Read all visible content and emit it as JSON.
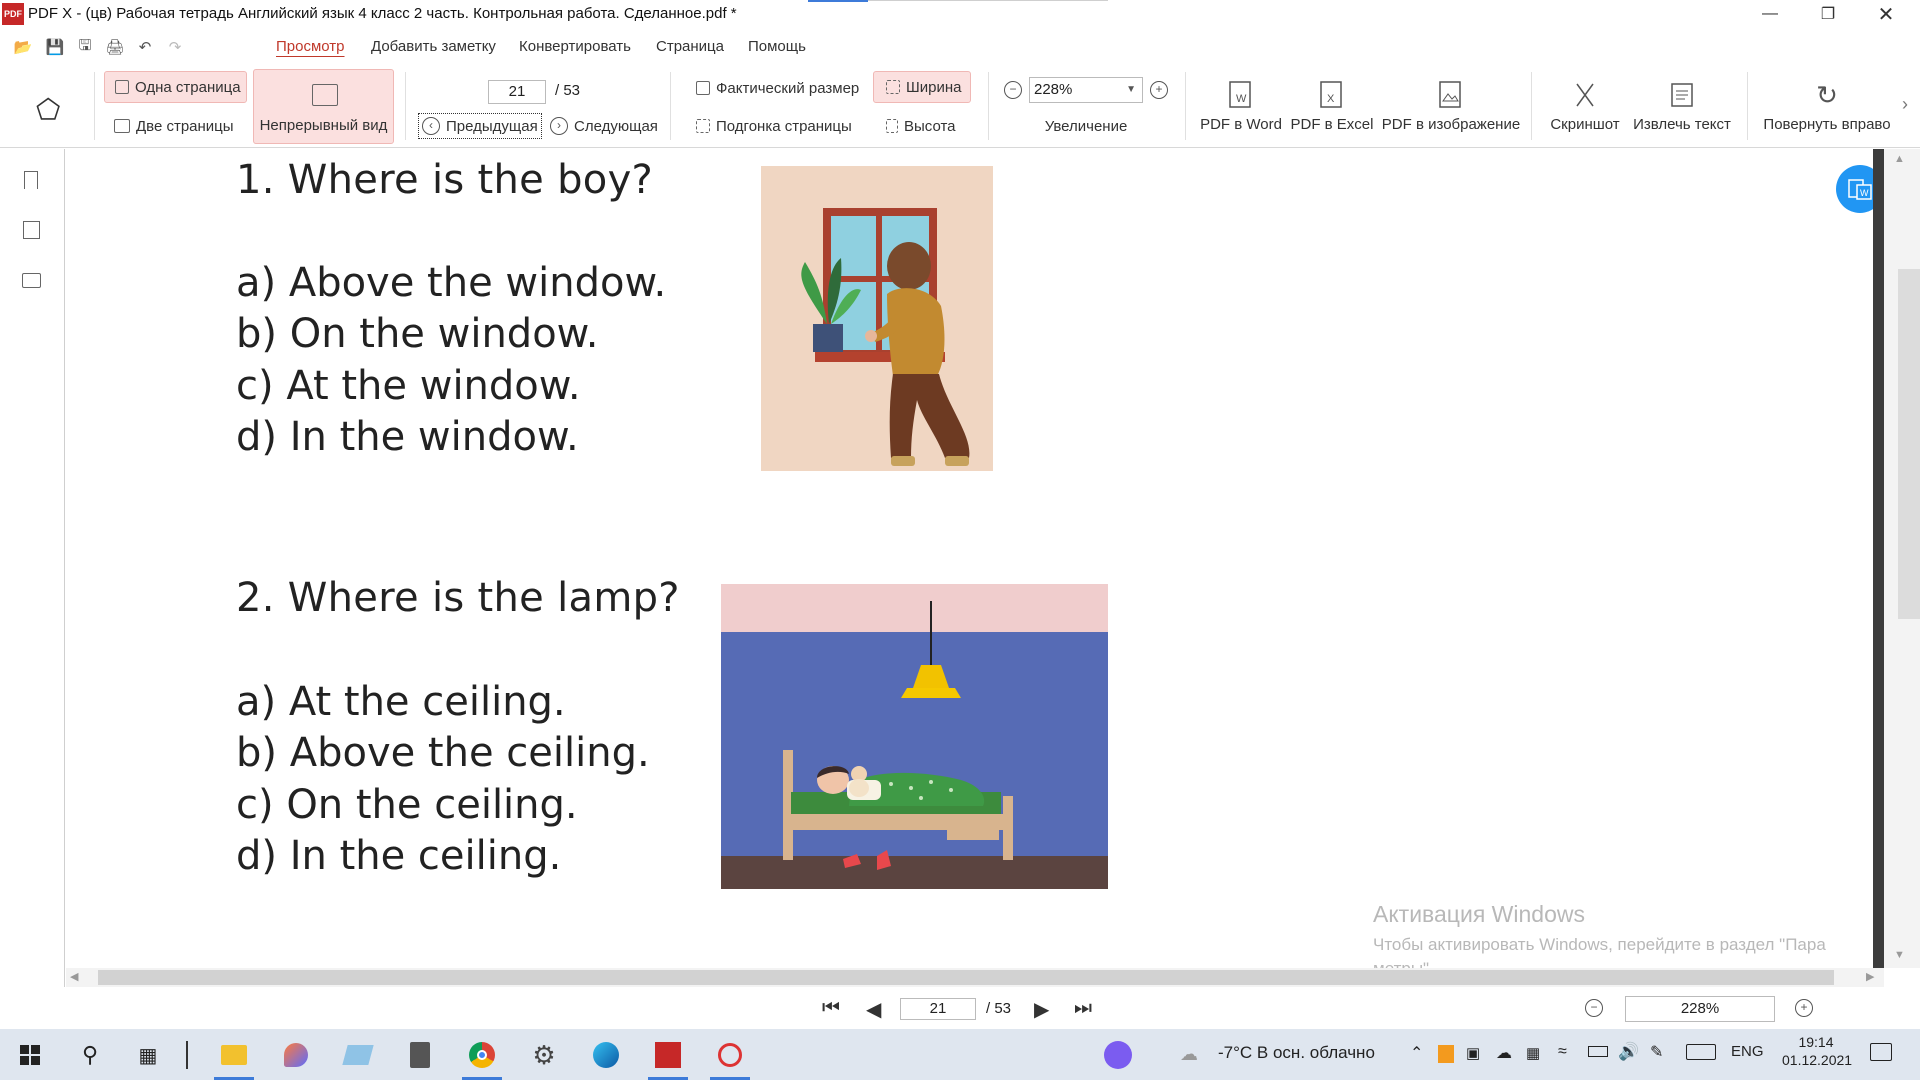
{
  "window": {
    "title": "PDF X - (цв) Рабочая тетрадь Английский язык 4 класс 2 часть. Контрольная работа. Сделанное.pdf *",
    "logo_text": "PDF"
  },
  "menu": {
    "items": [
      "Просмотр",
      "Добавить заметку",
      "Конвертировать",
      "Страница",
      "Помощь"
    ]
  },
  "ribbon": {
    "single_page": "Одна страница",
    "two_pages": "Две страницы",
    "continuous": "Непрерывный вид",
    "page_current": "21",
    "page_total": "/ 53",
    "prev": "Предыдущая",
    "next": "Следующая",
    "actual_size": "Фактический размер",
    "fit_page": "Подгонка страницы",
    "width": "Ширина",
    "height": "Высота",
    "zoom_value": "228%",
    "zoom_label": "Увеличение",
    "pdf_word": "PDF в Word",
    "pdf_excel": "PDF в Excel",
    "pdf_image": "PDF в изображение",
    "screenshot": "Скриншот",
    "extract_text": "Извлечь текст",
    "rotate_right": "Повернуть вправо"
  },
  "document": {
    "q1": {
      "question": "1. Where is the boy?",
      "options": [
        "a) Above the window.",
        "b) On the window.",
        "c) At the window.",
        "d) In the window."
      ]
    },
    "q2": {
      "question": "2. Where is the lamp?",
      "options": [
        "a) At the ceiling.",
        "b) Above the ceiling.",
        "c) On the ceiling.",
        "d) In the ceiling."
      ]
    },
    "watermark_title": "Активация Windows",
    "watermark_text_1": "Чтобы активировать Windows, перейдите в раздел \"Пара",
    "watermark_text_2": "метры\"."
  },
  "statusbar": {
    "page_current": "21",
    "page_total": "/ 53",
    "zoom": "228%"
  },
  "taskbar": {
    "weather": "-7°C  В осн. облачно",
    "lang": "ENG",
    "time": "19:14",
    "date": "01.12.2021"
  },
  "colors": {
    "accent": "#c0392b",
    "selected_bg": "#fbe0df",
    "boy_bg": "#f0d6c2",
    "room_wall": "#566bb5",
    "room_ceiling": "#f0cdcd",
    "room_floor": "#5b4440",
    "taskbar_bg": "#dfe6ef"
  }
}
